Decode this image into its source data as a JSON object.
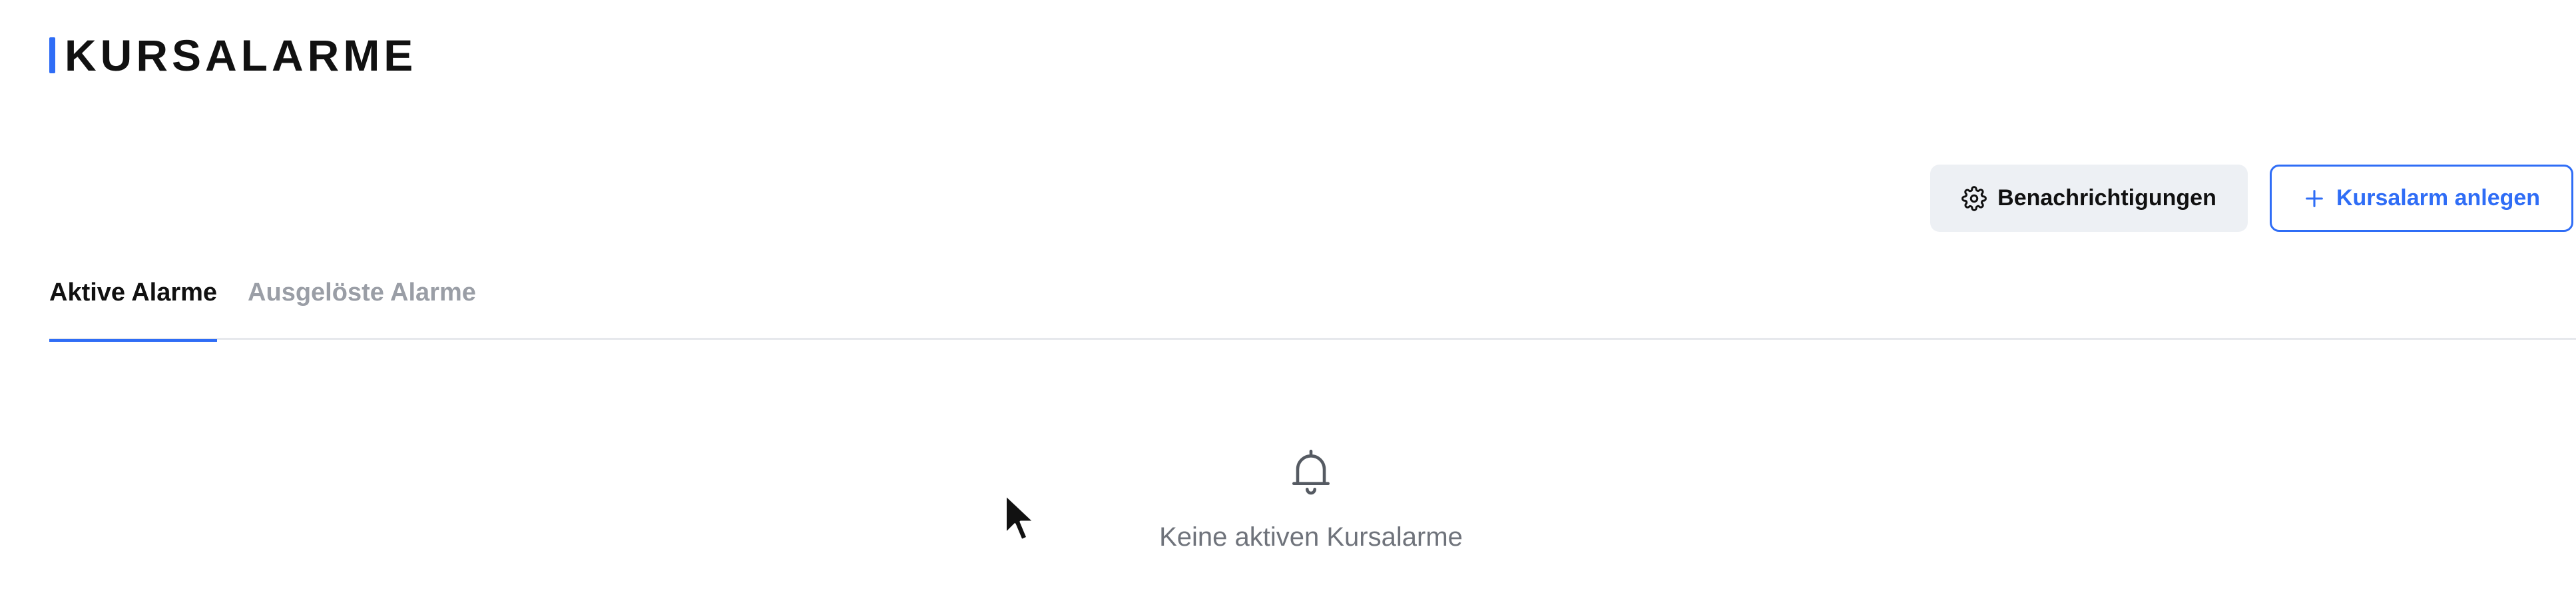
{
  "page": {
    "title": "KURSALARME",
    "accent_color": "#2f6df6"
  },
  "actions": {
    "notifications_label": "Benachrichtigungen",
    "notifications_icon": "gear-icon",
    "add_alarm_label": "Kursalarm anlegen",
    "add_alarm_icon": "plus-icon"
  },
  "tabs": [
    {
      "label": "Aktive Alarme",
      "active": true
    },
    {
      "label": "Ausgelöste Alarme",
      "active": false
    }
  ],
  "empty_state": {
    "icon": "bell-icon",
    "message": "Keine aktiven Kursalarme"
  },
  "cursor": {
    "icon": "mouse-pointer-icon"
  }
}
